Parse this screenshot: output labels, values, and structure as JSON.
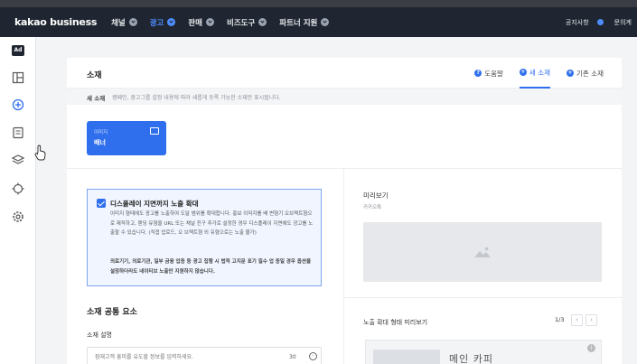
{
  "topnav": {
    "logo": "kakao business",
    "items": [
      {
        "label": "채널",
        "active": false
      },
      {
        "label": "광고",
        "active": true
      },
      {
        "label": "판매",
        "active": false
      },
      {
        "label": "비즈도구",
        "active": false
      },
      {
        "label": "파트너 지원",
        "active": false
      }
    ],
    "right": {
      "notice": "공지사항",
      "inquiry": "문의계"
    }
  },
  "sidebar": {
    "icons": [
      "ad-icon",
      "dashboard-icon",
      "add-circle-icon",
      "report-icon",
      "layers-icon",
      "target-icon",
      "settings-icon"
    ],
    "ad_label": "Ad"
  },
  "header": {
    "title": "소재",
    "tabs": [
      {
        "label": "도움말",
        "active": false
      },
      {
        "label": "새 소재",
        "active": true
      },
      {
        "label": "기존 소재",
        "active": false
      }
    ]
  },
  "description": {
    "label": "새 소재",
    "text": "캠페인, 광고그룹 설정 내용에 따라 새롭게 등록 가능한 소재만 표시됩니다."
  },
  "format_card": {
    "small": "이미지",
    "label": "배너"
  },
  "notice_box": {
    "checked": true,
    "title": "디스플레이 지면까지 노출 확대",
    "p1": "이미지 형태에도 광고를 노출하여 도달 범위를 확대합니다. 홍보 이미지를 배 변형기 오브젝트형으로 제작하고, 랜딩 유형을 URL 또는 채널 친구 추가로 설정한 경우 디스플레이 지면에도 광고를 노출할 수 있습니다. (직접 업로드, 오 브젝트형 외 유형으로는 노출 불가)",
    "p2": "의료기기, 의료기관, 일부 금융 업종 등 광고 집행 시 법적 고지문 표기 필수 업 종일 경우 옵션을 설정하더라도 네이티브 노출만 지원하지 않습니다."
  },
  "common": {
    "section_title": "소재 공통 요소",
    "field_label": "소재 설명",
    "placeholder": "잠재고객 흥미를 유도할 정보를 입력하세요.",
    "count": "30"
  },
  "preview": {
    "title": "미리보기",
    "subtitle": "카카오톡",
    "expanded_title": "노출 확대 형태 미리보기",
    "page": "1/3",
    "card_text": "메인 카피"
  },
  "colors": {
    "accent": "#2f6fed",
    "nav_bg": "#1f2631"
  }
}
